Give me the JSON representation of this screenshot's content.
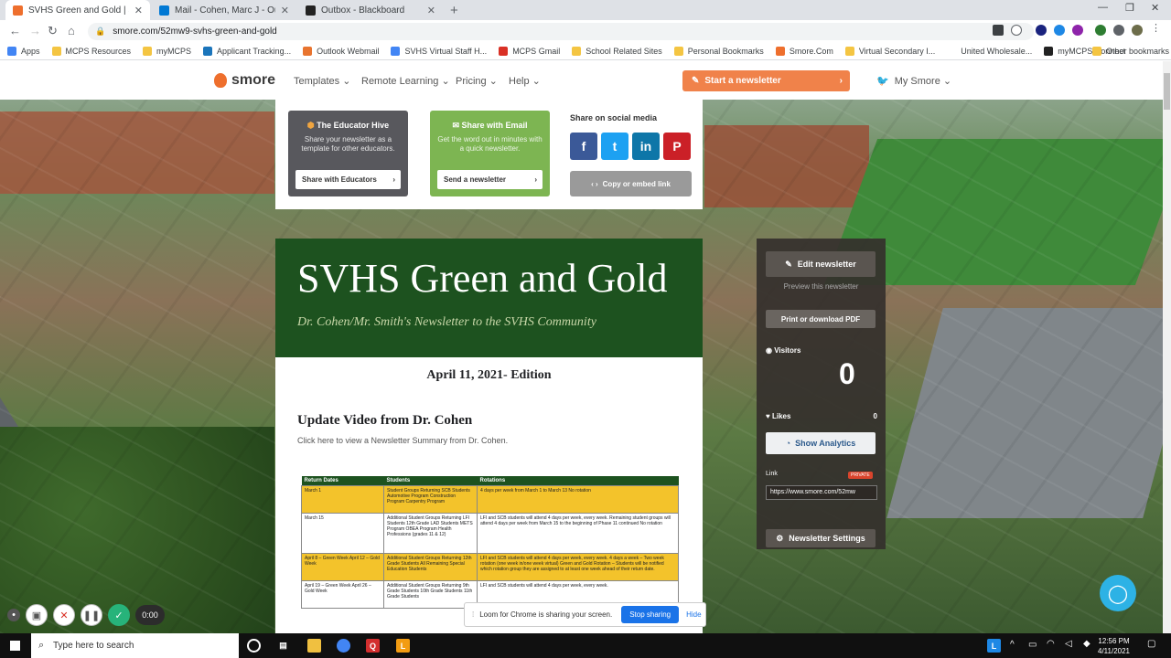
{
  "tabs": [
    {
      "title": "SVHS Green and Gold | Smore Ne",
      "color": "#ee6f2d"
    },
    {
      "title": "Mail - Cohen, Marc J - Outlook",
      "color": "#0078d4"
    },
    {
      "title": "Outbox - Blackboard",
      "color": "#222222"
    }
  ],
  "url": "smore.com/52mw9-svhs-green-and-gold",
  "bookmarks": [
    {
      "label": "Apps",
      "color": "#4285f4"
    },
    {
      "label": "MCPS Resources",
      "color": "#f4c542"
    },
    {
      "label": "myMCPS",
      "color": "#f4c542"
    },
    {
      "label": "Applicant Tracking...",
      "color": "#1b75bb"
    },
    {
      "label": "Outlook Webmail",
      "color": "#e8742f"
    },
    {
      "label": "SVHS Virtual Staff H...",
      "color": "#4285f4"
    },
    {
      "label": "MCPS Gmail",
      "color": "#d93025"
    },
    {
      "label": "School Related Sites",
      "color": "#f4c542"
    },
    {
      "label": "Personal Bookmarks",
      "color": "#f4c542"
    },
    {
      "label": "Smore.Com",
      "color": "#ee6f2d"
    },
    {
      "label": "Virtual Secondary I...",
      "color": "#f4c542"
    },
    {
      "label": "United Wholesale...",
      "color": "#ffffff"
    },
    {
      "label": "myMCPS Connect",
      "color": "#222222"
    }
  ],
  "other_bookmarks": "Other bookmarks",
  "app": {
    "logo": "smore",
    "menu": [
      "Templates",
      "Remote Learning",
      "Pricing",
      "Help"
    ],
    "start": "Start a newsletter",
    "my": "My Smore"
  },
  "share": {
    "hive_title": "The Educator Hive",
    "hive_sub": "Share your newsletter as a template for other educators.",
    "hive_btn": "Share with Educators",
    "email_title": "Share with Email",
    "email_sub": "Get the word out in minutes with a quick newsletter.",
    "email_btn": "Send a newsletter",
    "social_title": "Share on social media",
    "embed": "Copy or embed link",
    "fb": "f",
    "tw": "t",
    "li": "in",
    "pi": "P"
  },
  "news": {
    "title": "SVHS Green and Gold",
    "subtitle": "Dr. Cohen/Mr. Smith's Newsletter to the SVHS Community",
    "edition": "April 11, 2021- Edition",
    "section": "Update Video from Dr. Cohen",
    "click": "Click here to view a Newsletter Summary from Dr. Cohen."
  },
  "table": {
    "headers": [
      "Return Dates",
      "Students",
      "Rotations"
    ],
    "rows": [
      {
        "dates": "March 1",
        "students": "Student Groups Returning SCB Students Automotive Program Construction Program Carpentry Program",
        "rot": "4 days per week from March 1 to March 13 No rotation",
        "hl": true
      },
      {
        "dates": "March 15",
        "students": "Additional Student Groups Returning LFI Students 12th Grade LAD Students METS Program OBEA Program Health Professions (grades 11 & 12)",
        "rot": "LFI and SCB students will attend 4 days per week, every week. Remaining student groups will attend 4 days per week from March 15 to the beginning of Phase 11 continued No rotation",
        "hl": false
      },
      {
        "dates": "April 8 – Green Week April 12 – Gold Week",
        "students": "Additional Student Groups Returning 12th Grade Students All Remaining Special Education Students",
        "rot": "LFI and SCB students will attend 4 days per week, every week. 4 days a week – Two week rotation (one week in/one week virtual) Green and Gold Rotation – Students will be notified which rotation group they are assigned to at least one week ahead of their return date.",
        "hl": true
      },
      {
        "dates": "April 19 – Green Week April 26 – Gold Week",
        "students": "Additional Student Groups Returning 9th Grade Students 10th Grade Students 11th Grade Students",
        "rot": "LFI and SCB students will attend 4 days per week, every week.",
        "hl": false
      }
    ]
  },
  "panel": {
    "edit": "Edit newsletter",
    "preview": "Preview this newsletter",
    "print": "Print or download PDF",
    "visitors": "Visitors",
    "visitors_count": "0",
    "likes": "Likes",
    "likes_count": "0",
    "analytics": "Show Analytics",
    "link": "Link",
    "private": "PRIVATE",
    "url": "https://www.smore.com/52mw",
    "settings": "Newsletter Settings"
  },
  "loom": {
    "timer": "0:00",
    "sharing": "Loom for Chrome is sharing your screen.",
    "stop": "Stop sharing",
    "hide": "Hide"
  },
  "taskbar": {
    "search": "Type here to search",
    "time": "12:56 PM",
    "date": "4/11/2021"
  }
}
